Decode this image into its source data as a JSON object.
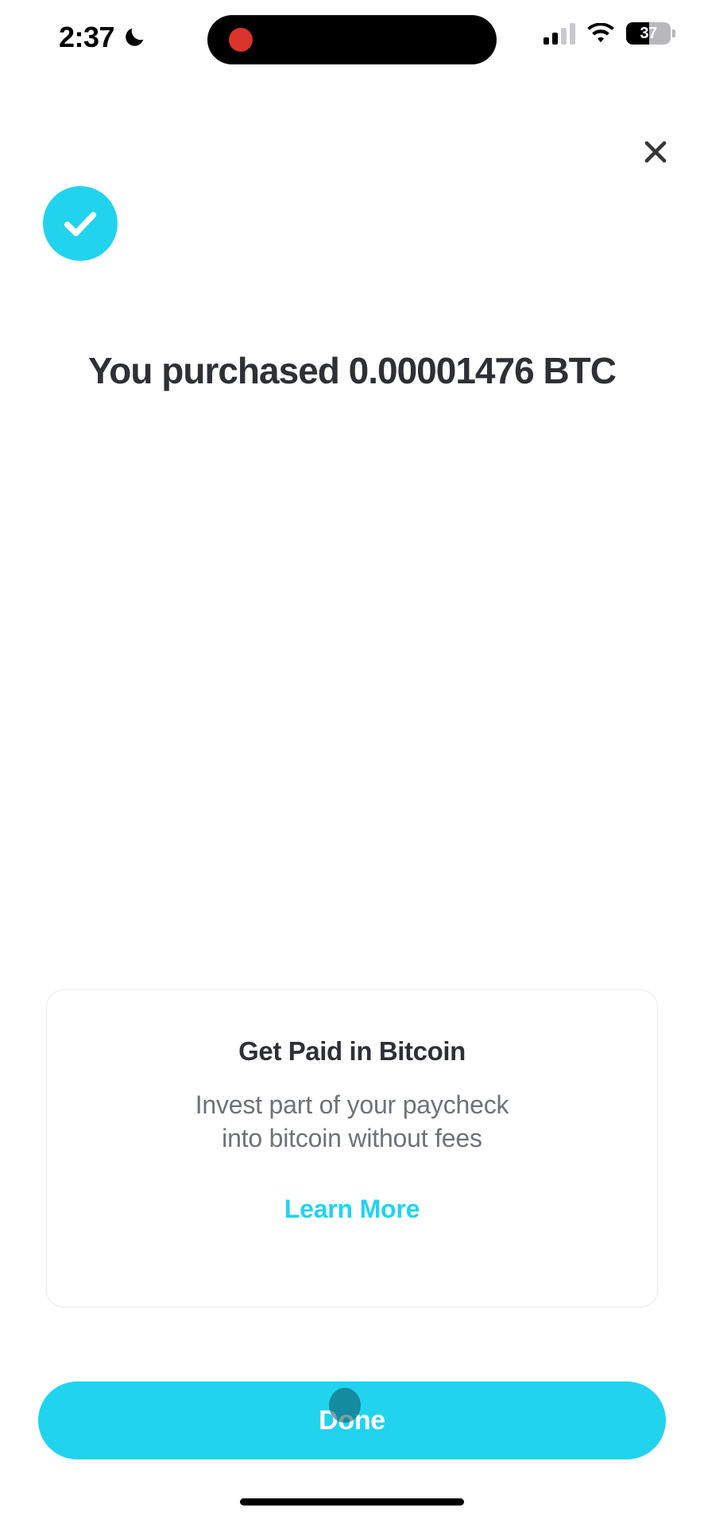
{
  "status_bar": {
    "time": "2:37",
    "moon_icon": "crescent-moon-icon",
    "recording_indicator": "recording-dot",
    "signal_icon": "cellular-signal-icon",
    "wifi_icon": "wifi-icon",
    "battery_percent": "37",
    "battery_level": 37
  },
  "header": {
    "close_icon": "close-icon"
  },
  "success": {
    "icon": "checkmark-circle-icon",
    "headline": "You purchased 0.00001476 BTC",
    "amount": "0.00001476",
    "asset": "BTC"
  },
  "promo": {
    "title": "Get Paid in Bitcoin",
    "subtitle_line1": "Invest part of your paycheck",
    "subtitle_line2": "into bitcoin without fees",
    "link_label": "Learn More"
  },
  "actions": {
    "done_label": "Done"
  },
  "colors": {
    "accent": "#22D3EE",
    "text_primary": "#2e3033",
    "text_secondary": "#6f7276",
    "card_border": "#e9e9ec",
    "recording": "#d9342b"
  }
}
